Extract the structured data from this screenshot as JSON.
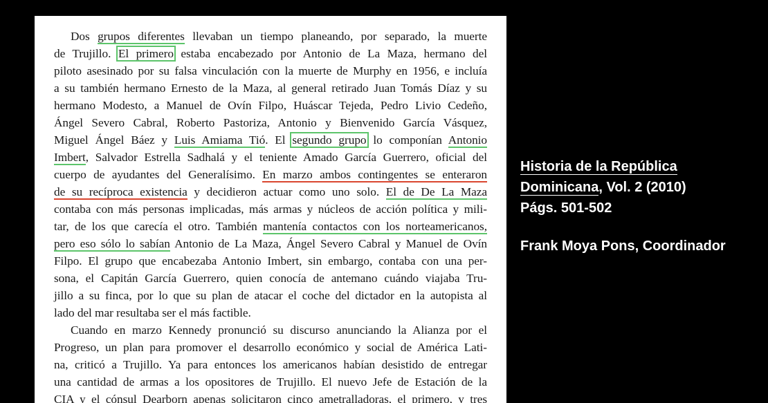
{
  "document": {
    "paragraph1": {
      "l1_t1": "Dos ",
      "l1_u1": "grupos diferentes",
      "l1_t2": " llevaban un tiempo planeando, por separado, la muerte",
      "l2_t1": "de Trujillo. ",
      "l2_b1": "El primero",
      "l2_t2": " estaba encabezado por Antonio de La Maza, hermano del",
      "l3": "piloto asesinado por su falsa vinculación con la muerte de Murphy en 1956, e incluía",
      "l4": "a su también hermano Ernesto de la Maza, al general retirado Juan Tomás Díaz y su",
      "l5": "hermano Modesto, a Manuel de Ovín Filpo, Huáscar Tejeda, Pedro Livio Cedeño,",
      "l6": "Ángel Severo Cabral, Roberto Pastoriza, Antonio y Bienvenido García Vásquez,",
      "l7_t1": "Miguel Ángel Báez y ",
      "l7_u1": "Luis Amiama Tió",
      "l7_t2": ". El ",
      "l7_b1": "segundo grupo",
      "l7_t3": " lo componían ",
      "l7_u2": "Antonio",
      "l8_u1": "Imbert",
      "l8_t1": ", Salvador Estrella Sadhalá y el teniente Amado García Guerrero, oficial del",
      "l9_t1": "cuerpo de ayudantes del Generalísimo. ",
      "l9_r1": "En marzo ambos contingentes se enteraron",
      "l10_r1": "de su recíproca existencia",
      "l10_t1": " y decidieron actuar como uno solo. ",
      "l10_u1": "El de De La Maza",
      "l11": "contaba con más personas implicadas, más armas y núcleos de acción política y mili-",
      "l12_t1": "tar, de los que carecía el otro. También ",
      "l12_u1": "mantenía contactos con los norteamericanos,",
      "l13_u1": "pero eso sólo lo sabían",
      "l13_t1": " Antonio de La Maza, Ángel Severo Cabral y Manuel de Ovín",
      "l14": "Filpo. El grupo que encabezaba Antonio Imbert, sin embargo, contaba con una per-",
      "l15": "sona, el Capitán García Guerrero, quien conocía de antemano cuándo viajaba Tru-",
      "l16": "jillo a su finca, por lo que su plan de atacar el coche del dictador en la autopista al",
      "l17": "lado del mar resultaba ser el más factible."
    },
    "paragraph2": {
      "l1": "Cuando en marzo Kennedy pronunció su discurso anunciando la Alianza por el",
      "l2": "Progreso, un plan para promover el desarrollo económico y social de América Lati-",
      "l3": "na, criticó a Trujillo. Ya para entonces los americanos habían desistido de entregar",
      "l4": "una cantidad de armas a los opositores de Trujillo. El nuevo Jefe de Estación de la",
      "l5": "CIA y el cónsul Dearborn apenas solicitaron cinco ametralladoras, el primero, y tres"
    }
  },
  "caption": {
    "title_line1": "Historia de la República",
    "title_line2_book": "Dominicana",
    "title_line2_rest": ", Vol. 2  (2010)",
    "pages": "Págs. 501-502",
    "author_name": "Frank Moya Pons",
    "author_role": ", Coordinador"
  },
  "colors": {
    "highlight_green": "#5cc46a",
    "highlight_red": "#d9452e",
    "background": "#000000",
    "page": "#ffffff"
  }
}
